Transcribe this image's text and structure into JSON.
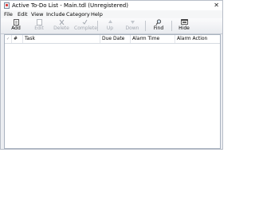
{
  "window": {
    "title": "Active To-Do List - Main.tdl (Unregistered)",
    "close_glyph": "✕"
  },
  "menu": {
    "items": [
      "File",
      "Edit",
      "View",
      "Include",
      "Category",
      "Help"
    ]
  },
  "toolbar": {
    "add": {
      "label": "Add",
      "icon": "add-icon",
      "enabled": true
    },
    "edit": {
      "label": "Edit",
      "icon": "edit-icon",
      "enabled": false
    },
    "delete": {
      "label": "Delete",
      "icon": "delete-icon",
      "enabled": false
    },
    "complete": {
      "label": "Complete",
      "icon": "complete-icon",
      "enabled": false
    },
    "up": {
      "label": "Up",
      "icon": "up-arrow-icon",
      "enabled": false
    },
    "down": {
      "label": "Down",
      "icon": "down-arrow-icon",
      "enabled": false
    },
    "find": {
      "label": "Find",
      "icon": "find-icon",
      "enabled": true
    },
    "hide": {
      "label": "Hide",
      "icon": "hide-icon",
      "enabled": true
    }
  },
  "table": {
    "columns": {
      "complete_glyph": "✓",
      "number": "#",
      "task": "Task",
      "due_date": "Due Date",
      "alarm_time": "Alarm Time",
      "alarm_action": "Alarm Action"
    },
    "rows": []
  },
  "colors": {
    "window_bg": "#eceef2",
    "disabled_text": "#a3a8b0",
    "list_border": "#a9b2bf"
  }
}
